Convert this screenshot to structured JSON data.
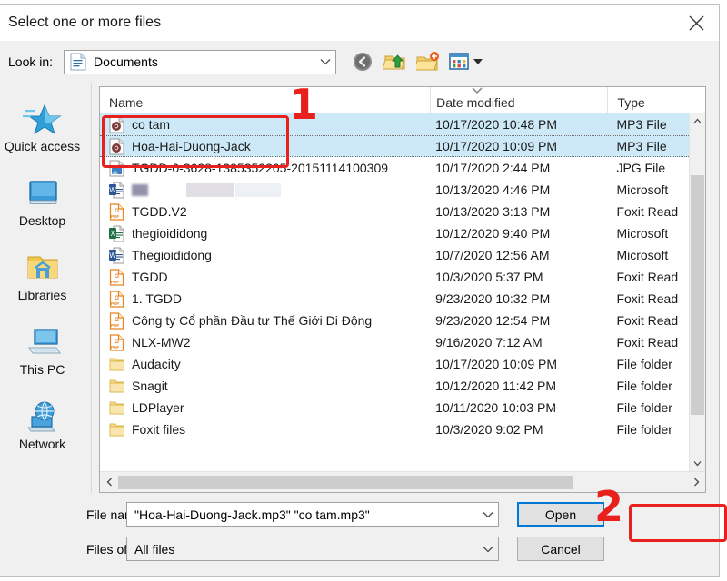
{
  "window": {
    "title": "Select one or more files",
    "close_icon": "close-icon"
  },
  "toolbar": {
    "lookin_label": "Look in:",
    "lookin_value": "Documents",
    "lookin_icon": "documents-folder-icon",
    "back_icon": "back-arrow-icon",
    "up_icon": "up-one-level-icon",
    "new_folder_icon": "new-folder-icon",
    "views_icon": "views-dropdown-icon"
  },
  "places": {
    "items": [
      {
        "label": "Quick access",
        "icon": "quick-access-star-icon"
      },
      {
        "label": "Desktop",
        "icon": "desktop-monitor-icon"
      },
      {
        "label": "Libraries",
        "icon": "libraries-folder-icon"
      },
      {
        "label": "This PC",
        "icon": "this-pc-computer-icon"
      },
      {
        "label": "Network",
        "icon": "network-globe-icon"
      }
    ]
  },
  "list": {
    "columns": [
      "Name",
      "Date modified",
      "Type"
    ],
    "sort_indicator": "sort-descending-chevron-icon",
    "rows": [
      {
        "name": "co tam",
        "date": "10/17/2020 10:48 PM",
        "type": "MP3 File",
        "icon": "mp3-file-icon",
        "selected": true
      },
      {
        "name": "Hoa-Hai-Duong-Jack",
        "date": "10/17/2020 10:09 PM",
        "type": "MP3 File",
        "icon": "mp3-file-icon",
        "selected": true
      },
      {
        "name": "TGDD-0-3628-1385352205-20151114100309",
        "date": "10/17/2020 2:44 PM",
        "type": "JPG File",
        "icon": "jpg-file-icon",
        "selected": false
      },
      {
        "name": "",
        "date": "10/13/2020 4:46 PM",
        "type": "Microsoft",
        "icon": "word-file-icon",
        "selected": false,
        "redacted": true
      },
      {
        "name": "TGDD.V2",
        "date": "10/13/2020 3:13 PM",
        "type": "Foxit Read",
        "icon": "pdf-file-icon",
        "selected": false
      },
      {
        "name": "thegioididong",
        "date": "10/12/2020 9:40 PM",
        "type": "Microsoft",
        "icon": "excel-file-icon",
        "selected": false
      },
      {
        "name": "Thegioididong",
        "date": "10/7/2020 12:56 AM",
        "type": "Microsoft",
        "icon": "word-file-icon",
        "selected": false
      },
      {
        "name": "TGDD",
        "date": "10/3/2020 5:37 PM",
        "type": "Foxit Read",
        "icon": "pdf-file-icon",
        "selected": false
      },
      {
        "name": "1. TGDD",
        "date": "9/23/2020 10:32 PM",
        "type": "Foxit Read",
        "icon": "pdf-file-icon",
        "selected": false
      },
      {
        "name": "Công ty Cổ phần Đầu tư Thế Giới Di Động",
        "date": "9/23/2020 12:54 PM",
        "type": "Foxit Read",
        "icon": "pdf-file-icon",
        "selected": false
      },
      {
        "name": "NLX-MW2",
        "date": "9/16/2020 7:12 AM",
        "type": "Foxit Read",
        "icon": "pdf-file-icon",
        "selected": false
      },
      {
        "name": "Audacity",
        "date": "10/17/2020 10:09 PM",
        "type": "File folder",
        "icon": "folder-icon",
        "selected": false
      },
      {
        "name": "Snagit",
        "date": "10/12/2020 11:42 PM",
        "type": "File folder",
        "icon": "folder-icon",
        "selected": false
      },
      {
        "name": "LDPlayer",
        "date": "10/11/2020 10:03 PM",
        "type": "File folder",
        "icon": "folder-icon",
        "selected": false
      },
      {
        "name": "Foxit files",
        "date": "10/3/2020 9:02 PM",
        "type": "File folder",
        "icon": "folder-icon",
        "selected": false
      }
    ]
  },
  "form": {
    "filename_label": "File name:",
    "filename_value": "\"Hoa-Hai-Duong-Jack.mp3\" \"co tam.mp3\"",
    "filetype_label": "Files of type:",
    "filetype_value": "All files",
    "open_label": "Open",
    "cancel_label": "Cancel"
  },
  "annotations": {
    "step1": "1",
    "step2": "2",
    "color": "#e8201e"
  }
}
